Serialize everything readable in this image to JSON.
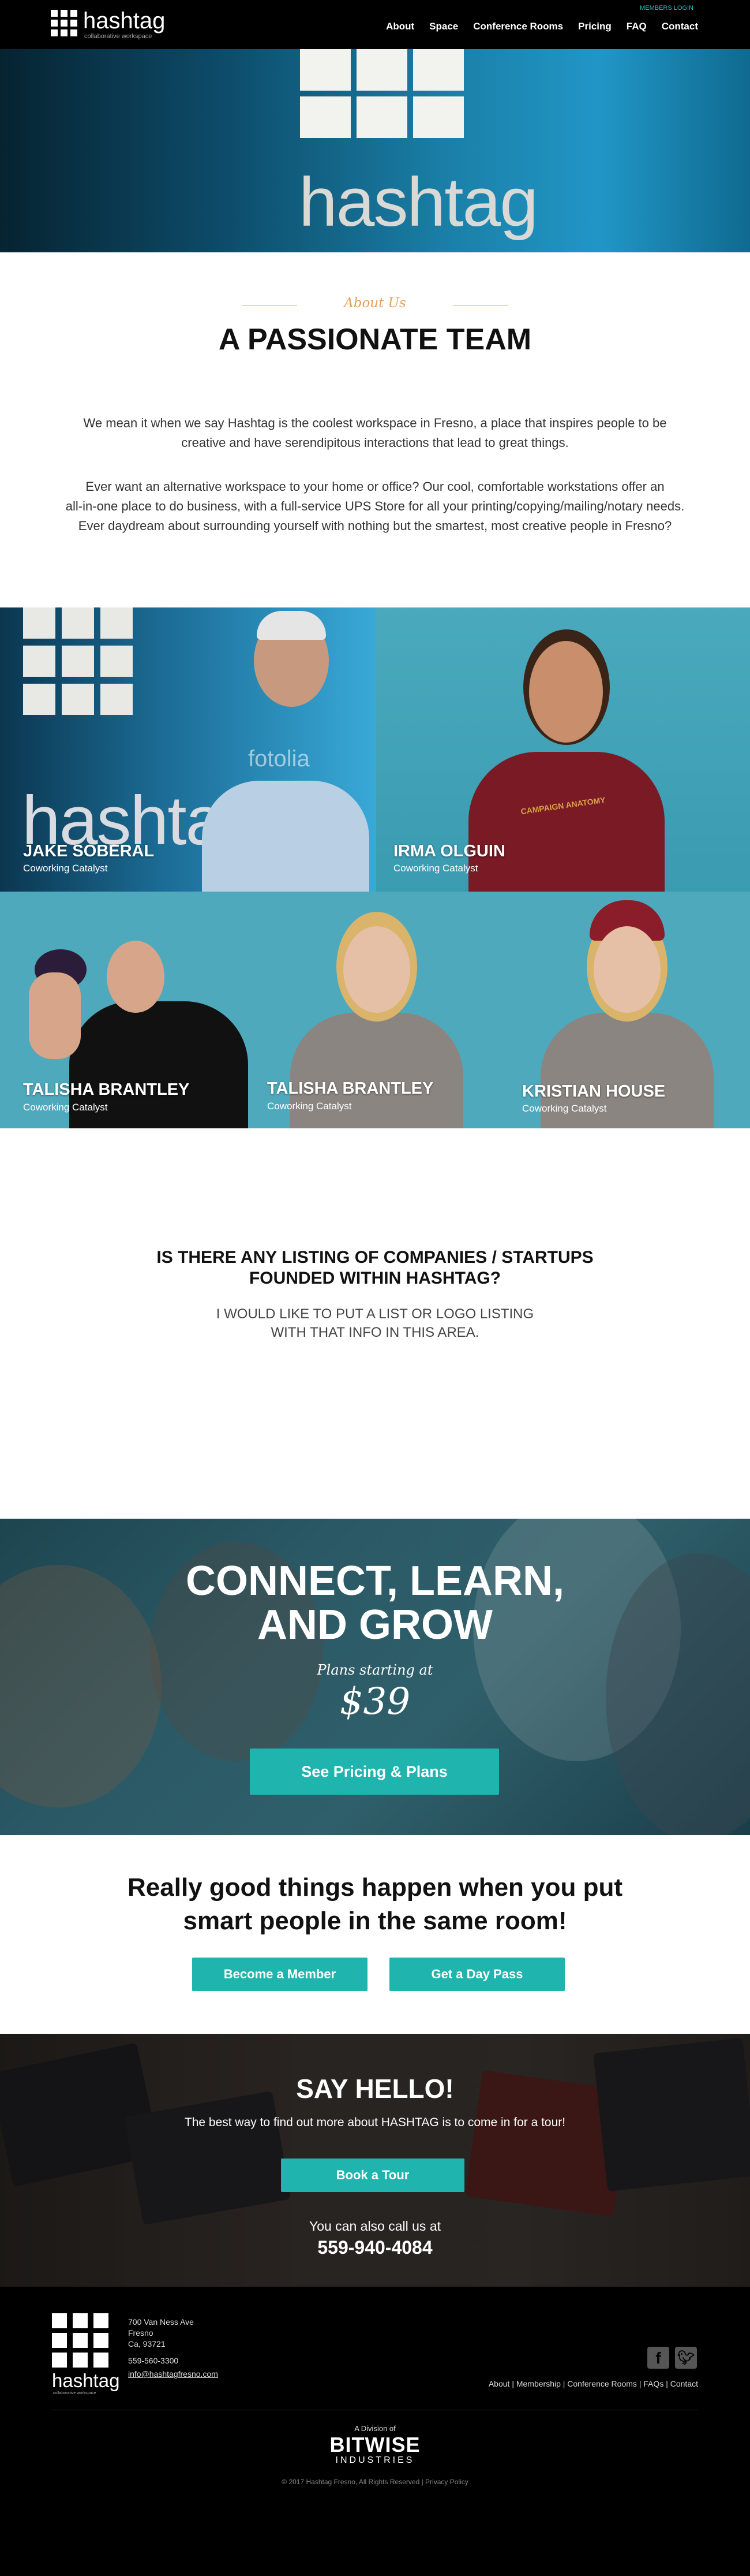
{
  "header": {
    "logo_word": "hashtag",
    "logo_sub": "collaborative workspace",
    "members_login": "MEMBERS LOGIN",
    "nav": [
      "About",
      "Space",
      "Conference Rooms",
      "Pricing",
      "FAQ",
      "Contact"
    ]
  },
  "hero": {
    "sign_word": "hashtag"
  },
  "about": {
    "eyebrow": "About Us",
    "title": "A PASSIONATE TEAM",
    "para1_l1": "We mean it when we say Hashtag is the coolest workspace in Fresno, a place that inspires people to be",
    "para1_l2": "creative and have serendipitous interactions that lead to great things.",
    "para2_l1": "Ever want an alternative workspace to your home or office? Our cool, comfortable workstations offer an",
    "para2_l2": "all-in-one place to do business, with a full-service UPS Store for all your printing/copying/mailing/notary needs.",
    "para2_l3": "Ever daydream about surrounding yourself with nothing but the smartest, most creative people in Fresno?"
  },
  "team": [
    {
      "name": "JAKE SOBERAL",
      "role": "Coworking Catalyst"
    },
    {
      "name": "IRMA OLGUIN",
      "role": "Coworking Catalyst"
    },
    {
      "name": "TALISHA BRANTLEY",
      "role": "Coworking Catalyst"
    },
    {
      "name": "TALISHA BRANTLEY",
      "role": "Coworking Catalyst"
    },
    {
      "name": "KRISTIAN HOUSE",
      "role": "Coworking Catalyst"
    }
  ],
  "team_photo_text": {
    "watermark": "fotolia",
    "shirt": "CAMPAIGN ANATOMY",
    "sign_word": "hashtag"
  },
  "listing": {
    "title_l1": "IS THERE ANY LISTING OF COMPANIES / STARTUPS",
    "title_l2": "FOUNDED WITHIN HASHTAG?",
    "body_l1": "I WOULD LIKE TO PUT A LIST OR LOGO LISTING",
    "body_l2": "WITH THAT INFO IN THIS AREA."
  },
  "connect": {
    "title_l1": "CONNECT, LEARN,",
    "title_l2": "AND GROW",
    "sub": "Plans starting at",
    "price": "$39",
    "button": "See Pricing & Plans"
  },
  "good": {
    "title_l1": "Really good things happen when you put",
    "title_l2": "smart people in the same room!",
    "btn_member": "Become a Member",
    "btn_daypass": "Get a Day Pass"
  },
  "hello": {
    "title": "SAY HELLO!",
    "text": "The best way to find out more about HASHTAG is to come in for a tour!",
    "button": "Book a Tour",
    "call": "You can also call us at",
    "phone": "559-940-4084"
  },
  "footer": {
    "logo_word": "hashtag",
    "logo_sub": "collaborative workspace",
    "addr1": "700 Van Ness Ave",
    "addr2": "Fresno",
    "addr3": "Ca, 93721",
    "phone": "559-560-3300",
    "email": "info@hashtagfresno.com",
    "links": "About | Membership | Conference Rooms | FAQs | Contact",
    "division": "A Division of",
    "bitwise": "BITWISE",
    "industries": "INDUSTRIES",
    "copyright": "© 2017 Hashtag Fresno, All Rights Reserved | Privacy Policy"
  },
  "colors": {
    "accent_teal": "#1fb4ad",
    "eyebrow_orange": "#e6a05a",
    "header_bg": "#000000"
  }
}
